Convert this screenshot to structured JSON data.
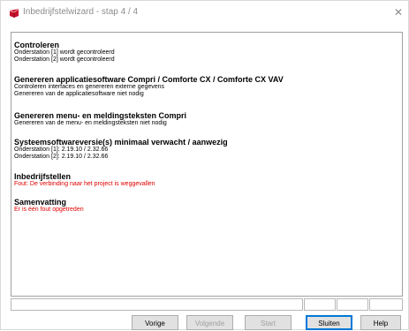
{
  "window": {
    "title": "Inbedrijfstelwizard - stap 4 / 4",
    "close_glyph": "✕"
  },
  "sections": [
    {
      "heading": "Controleren",
      "lines": [
        {
          "text": "Onderstation [1] wordt gecontroleerd",
          "error": false
        },
        {
          "text": "Onderstation [2] wordt gecontroleerd",
          "error": false
        }
      ]
    },
    {
      "heading": "Genereren applicatiesoftware Compri / Comforte CX / Comforte CX VAV",
      "lines": [
        {
          "text": "Controleren interfaces en genereren externe gegevens",
          "error": false
        },
        {
          "text": "Genereren van de applicatiesoftware niet nodig",
          "error": false
        }
      ]
    },
    {
      "heading": "Genereren menu- en meldingsteksten Compri",
      "lines": [
        {
          "text": "Genereren van de menu- en meldingsteksten niet nodig",
          "error": false
        }
      ]
    },
    {
      "heading": "Systeemsoftwareversie(s) minimaal verwacht / aanwezig",
      "lines": [
        {
          "text": "Onderstation [1]: 2.19.10 / 2.32.66",
          "error": false
        },
        {
          "text": "Onderstation [2]: 2.19.10 / 2.32.66",
          "error": false
        }
      ]
    },
    {
      "heading": "Inbedrijfstellen",
      "lines": [
        {
          "text": "Fout: De verbinding naar het project is weggevallen",
          "error": true
        }
      ]
    },
    {
      "heading": "Samenvatting",
      "lines": [
        {
          "text": "Er is één fout opgetreden",
          "error": true
        }
      ]
    }
  ],
  "buttons": {
    "previous": "Vorige",
    "next": "Volgende",
    "start": "Start",
    "close": "Sluiten",
    "help": "Help"
  },
  "colors": {
    "error_text": "#e00000",
    "default_button_border": "#0078d7"
  }
}
